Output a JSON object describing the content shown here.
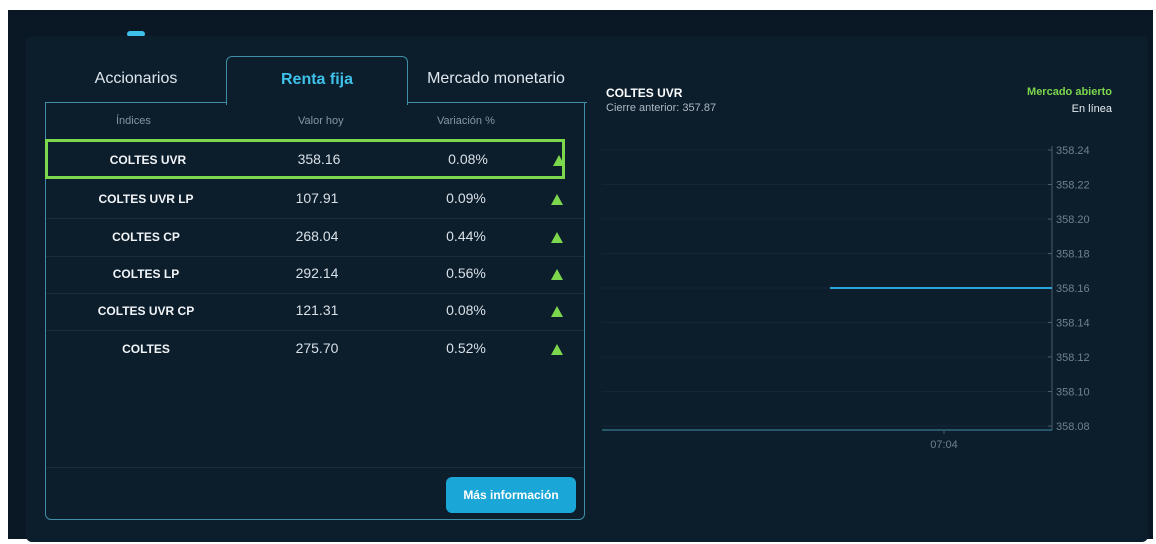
{
  "tabs": [
    "Accionarios",
    "Renta fija",
    "Mercado monetario"
  ],
  "table": {
    "headers": [
      "Índices",
      "Valor hoy",
      "Variación %"
    ],
    "rows": [
      {
        "name": "COLTES UVR",
        "value": "358.16",
        "change": "0.08%",
        "trend": "up"
      },
      {
        "name": "COLTES UVR LP",
        "value": "107.91",
        "change": "0.09%",
        "trend": "up"
      },
      {
        "name": "COLTES CP",
        "value": "268.04",
        "change": "0.44%",
        "trend": "up"
      },
      {
        "name": "COLTES LP",
        "value": "292.14",
        "change": "0.56%",
        "trend": "up"
      },
      {
        "name": "COLTES UVR CP",
        "value": "121.31",
        "change": "0.08%",
        "trend": "up"
      },
      {
        "name": "COLTES",
        "value": "275.70",
        "change": "0.52%",
        "trend": "up"
      }
    ],
    "button_label": "Más información"
  },
  "chart": {
    "title": "COLTES UVR",
    "subtitle": "Cierre anterior: 357.87",
    "status": "Mercado abierto",
    "connection": "En línea"
  },
  "colors": {
    "accent": "#3ec1ea",
    "up": "#7cd74d",
    "panel": "#0c1d2c"
  },
  "chart_data": {
    "type": "line",
    "x": [
      "07:04"
    ],
    "series": [
      {
        "values": [
          358.16
        ]
      }
    ],
    "xlabel": "",
    "ylabel": "",
    "ylim": [
      358.08,
      358.24
    ],
    "yticks": [
      "358.24",
      "358.22",
      "358.20",
      "358.18",
      "358.16",
      "358.14",
      "358.12",
      "358.10",
      "358.08"
    ],
    "xticks": [
      "07:04"
    ]
  }
}
